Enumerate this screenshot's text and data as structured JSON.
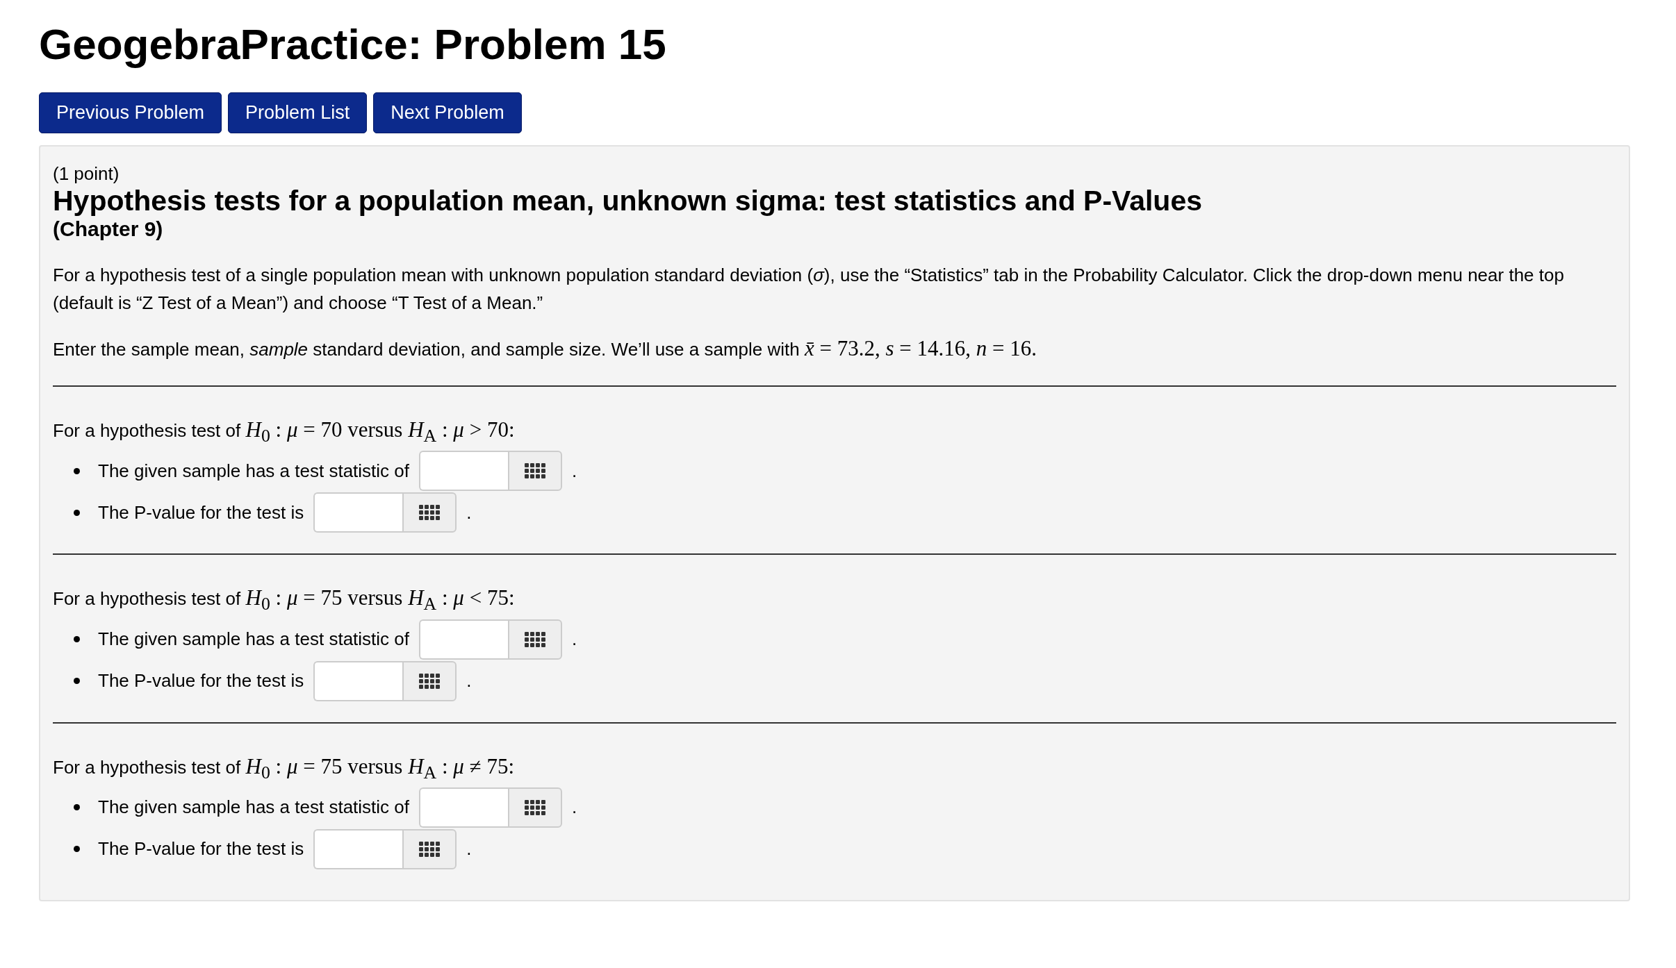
{
  "page_title": "GeogebraPractice: Problem 15",
  "nav_buttons": [
    "Previous Problem",
    "Problem List",
    "Next Problem"
  ],
  "problem": {
    "points": "(1 point)",
    "title": "Hypothesis tests for a population mean, unknown sigma: test statistics and P-Values",
    "chapter": "(Chapter 9)",
    "paragraphs": [
      {
        "text": "For a hypothesis test of a single population mean with unknown population standard deviation (*σ*), use the “Statistics” tab in the Probability Calculator. Click the drop-down menu near the top (default is “Z Test of a Mean”) and choose “T Test of a Mean.”"
      },
      {
        "text": "Enter the sample mean, *sample* standard deviation, and sample size. We’ll use a sample with",
        "formula": "*x̄* = 73.2, *s* = 14.16, *n* = 16."
      }
    ],
    "parts": [
      {
        "prompt": "For a hypothesis test of",
        "formula": "*H*$_{0}$ : *μ* = 70 versus *H*$_{A}$ : *μ* > 70:",
        "items": [
          {
            "label": "The given sample has a test statistic of",
            "end": "."
          },
          {
            "label": "The P-value for the test is",
            "end": "."
          }
        ]
      },
      {
        "prompt": "For a hypothesis test of",
        "formula": "*H*$_{0}$ : *μ* = 75 versus *H*$_{A}$ : *μ* < 75:",
        "items": [
          {
            "label": "The given sample has a test statistic of",
            "end": "."
          },
          {
            "label": "The P-value for the test is",
            "end": "."
          }
        ]
      },
      {
        "prompt": "For a hypothesis test of",
        "formula": "*H*$_{0}$ : *μ* = 75 versus *H*$_{A}$ : *μ* ≠ 75:",
        "items": [
          {
            "label": "The given sample has a test statistic of",
            "end": "."
          },
          {
            "label": "The P-value for the test is",
            "end": "."
          }
        ]
      }
    ]
  }
}
